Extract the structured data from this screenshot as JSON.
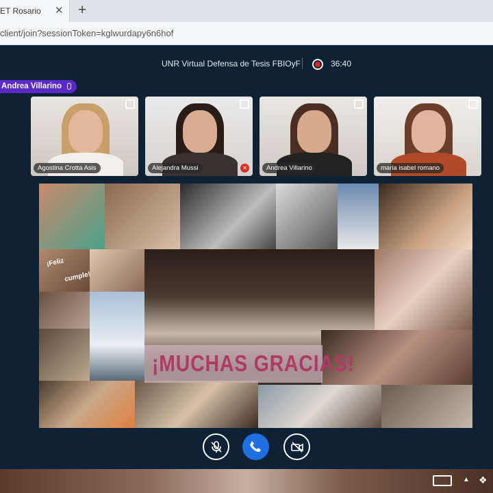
{
  "browser": {
    "tab_title": "ET Rosario",
    "url": "client/join?sessionToken=kglwurdapy6n6hof"
  },
  "meeting": {
    "title": "UNR Virtual Defensa de Tesis FBIOyF",
    "timer": "36:40",
    "active_speaker": "Andrea Villarino"
  },
  "participants": [
    {
      "name": "Agostina Crotta Asis",
      "muted": false
    },
    {
      "name": "Alejandra Mussi",
      "muted": true
    },
    {
      "name": "Andrea Villarino",
      "muted": false
    },
    {
      "name": "maria isabel romano",
      "muted": false
    }
  ],
  "shared_content": {
    "banner_text": "¡MUCHAS GRACIAS!",
    "sign_line1": "¡Feliz",
    "sign_line2": "cumple!"
  },
  "controls": {
    "mic": "mic-off-icon",
    "hangup": "phone-icon",
    "camera": "camera-off-icon"
  },
  "colors": {
    "background": "#0f2135",
    "speaker_badge": "#5b28c9",
    "record": "#e02424",
    "hangup": "#1f6fe0",
    "banner_text": "#b03a66"
  }
}
